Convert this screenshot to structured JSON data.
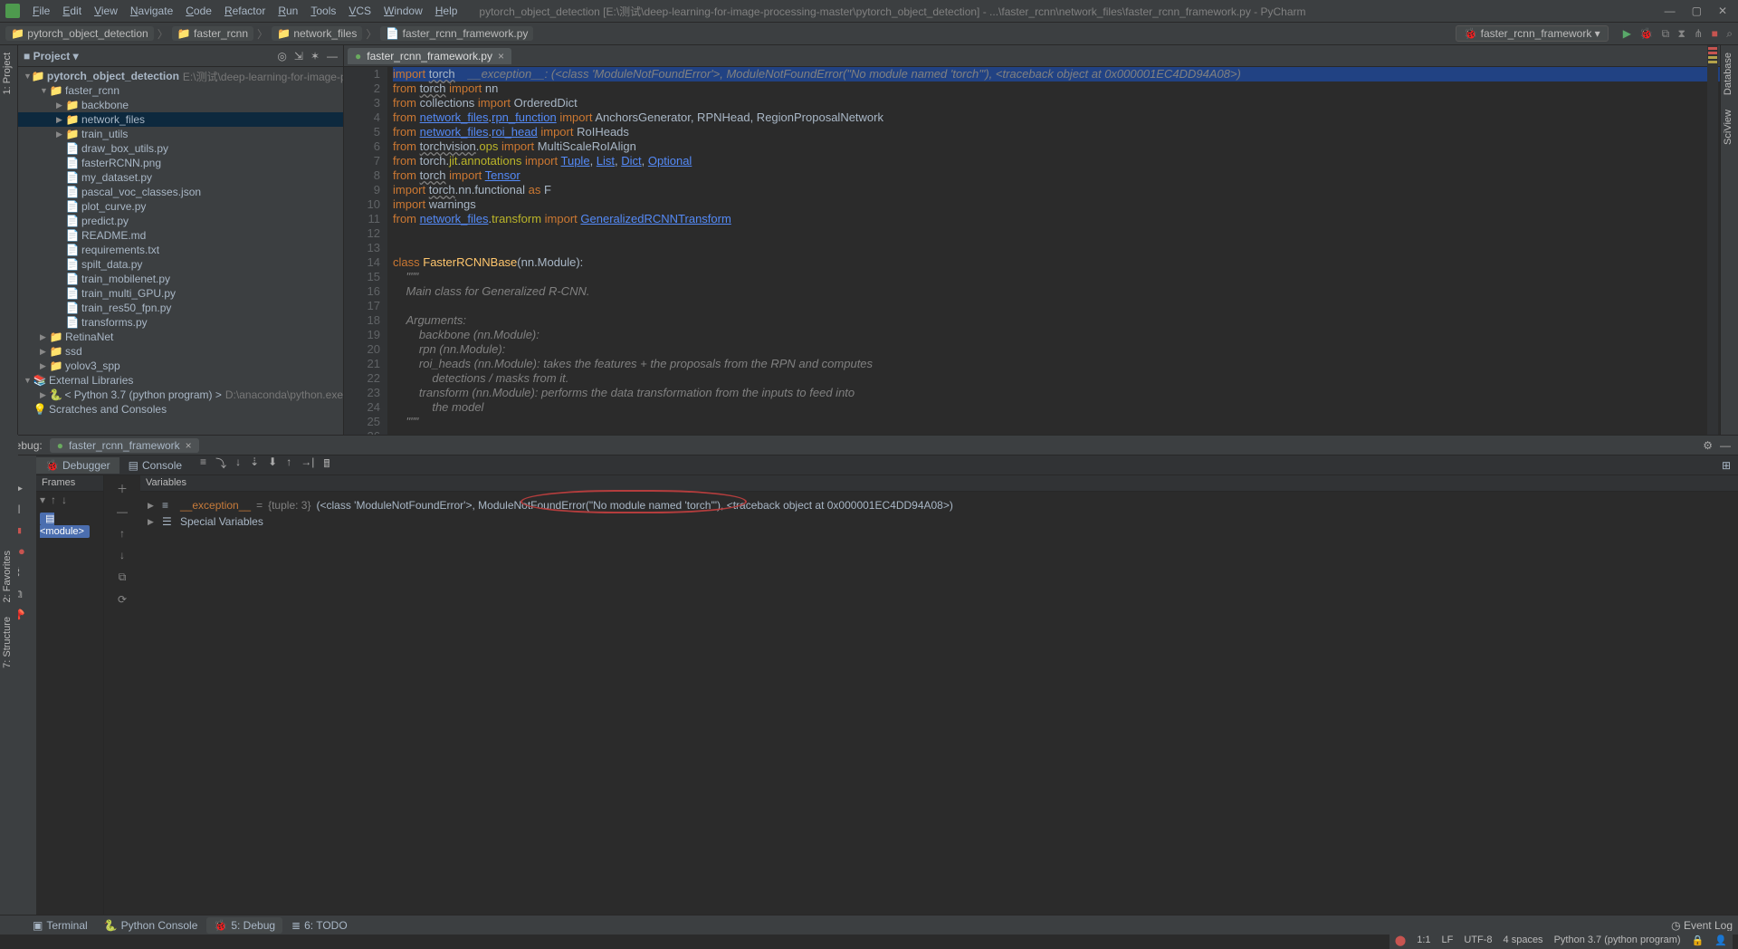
{
  "title": "pytorch_object_detection [E:\\测试\\deep-learning-for-image-processing-master\\pytorch_object_detection] - ...\\faster_rcnn\\network_files\\faster_rcnn_framework.py - PyCharm",
  "menu": [
    "File",
    "Edit",
    "View",
    "Navigate",
    "Code",
    "Refactor",
    "Run",
    "Tools",
    "VCS",
    "Window",
    "Help"
  ],
  "breadcrumb": [
    "pytorch_object_detection",
    "faster_rcnn",
    "network_files",
    "faster_rcnn_framework.py"
  ],
  "run_config": "faster_rcnn_framework",
  "project_pane": {
    "title": "Project"
  },
  "tree": [
    {
      "d": 0,
      "arrow": "▼",
      "ic": "📁",
      "lbl": "pytorch_object_detection",
      "hint": "E:\\测试\\deep-learning-for-image-processing-m",
      "bold": true
    },
    {
      "d": 1,
      "arrow": "▼",
      "ic": "📁",
      "lbl": "faster_rcnn"
    },
    {
      "d": 2,
      "arrow": "▶",
      "ic": "📁",
      "lbl": "backbone"
    },
    {
      "d": 2,
      "arrow": "▶",
      "ic": "📁",
      "lbl": "network_files",
      "selected": true
    },
    {
      "d": 2,
      "arrow": "▶",
      "ic": "📁",
      "lbl": "train_utils"
    },
    {
      "d": 2,
      "arrow": "",
      "ic": "📄",
      "lbl": "draw_box_utils.py"
    },
    {
      "d": 2,
      "arrow": "",
      "ic": "📄",
      "lbl": "fasterRCNN.png"
    },
    {
      "d": 2,
      "arrow": "",
      "ic": "📄",
      "lbl": "my_dataset.py"
    },
    {
      "d": 2,
      "arrow": "",
      "ic": "📄",
      "lbl": "pascal_voc_classes.json"
    },
    {
      "d": 2,
      "arrow": "",
      "ic": "📄",
      "lbl": "plot_curve.py"
    },
    {
      "d": 2,
      "arrow": "",
      "ic": "📄",
      "lbl": "predict.py"
    },
    {
      "d": 2,
      "arrow": "",
      "ic": "📄",
      "lbl": "README.md"
    },
    {
      "d": 2,
      "arrow": "",
      "ic": "📄",
      "lbl": "requirements.txt"
    },
    {
      "d": 2,
      "arrow": "",
      "ic": "📄",
      "lbl": "spilt_data.py"
    },
    {
      "d": 2,
      "arrow": "",
      "ic": "📄",
      "lbl": "train_mobilenet.py"
    },
    {
      "d": 2,
      "arrow": "",
      "ic": "📄",
      "lbl": "train_multi_GPU.py"
    },
    {
      "d": 2,
      "arrow": "",
      "ic": "📄",
      "lbl": "train_res50_fpn.py"
    },
    {
      "d": 2,
      "arrow": "",
      "ic": "📄",
      "lbl": "transforms.py"
    },
    {
      "d": 1,
      "arrow": "▶",
      "ic": "📁",
      "lbl": "RetinaNet"
    },
    {
      "d": 1,
      "arrow": "▶",
      "ic": "📁",
      "lbl": "ssd"
    },
    {
      "d": 1,
      "arrow": "▶",
      "ic": "📁",
      "lbl": "yolov3_spp"
    },
    {
      "d": 0,
      "arrow": "▼",
      "ic": "📚",
      "lbl": "External Libraries"
    },
    {
      "d": 1,
      "arrow": "▶",
      "ic": "🐍",
      "lbl": "< Python 3.7 (python program) >",
      "hint": "D:\\anaconda\\python.exe"
    },
    {
      "d": 0,
      "arrow": "",
      "ic": "💡",
      "lbl": "Scratches and Consoles"
    }
  ],
  "editor_tab": "faster_rcnn_framework.py",
  "code_lines": [
    {
      "n": 1,
      "html": "<span class='kw'>import</span> <span class='wave'>torch</span>    <span class='err'>__exception__: (&lt;class 'ModuleNotFoundError'&gt;, ModuleNotFoundError(\"No module named 'torch'\"), &lt;traceback object at 0x000001EC4DD94A08&gt;)</span>",
      "hl": true,
      "bolt": true
    },
    {
      "n": 2,
      "html": "<span class='kw'>from</span> <span class='wave'>torch</span> <span class='kw'>import</span> nn"
    },
    {
      "n": 3,
      "html": "<span class='kw'>from</span> collections <span class='kw'>import</span> OrderedDict"
    },
    {
      "n": 4,
      "html": "<span class='kw'>from</span> <span class='link'>network_files</span>.<span class='link'>rpn_function</span> <span class='kw'>import</span> AnchorsGenerator, RPNHead, RegionProposalNetwork"
    },
    {
      "n": 5,
      "html": "<span class='kw'>from</span> <span class='link'>network_files</span>.<span class='link'>roi_head</span> <span class='kw'>import</span> RoIHeads"
    },
    {
      "n": 6,
      "html": "<span class='kw'>from</span> <span class='wave'>torchvision</span>.<span class='dec'>ops</span> <span class='kw'>import</span> MultiScaleRoIAlign"
    },
    {
      "n": 7,
      "html": "<span class='kw'>from</span> torch.<span class='dec'>jit</span>.<span class='dec'>annotations</span> <span class='kw'>import</span> <span class='link'>Tuple</span>, <span class='link'>List</span>, <span class='link'>Dict</span>, <span class='link'>Optional</span>"
    },
    {
      "n": 8,
      "html": "<span class='kw'>from</span> <span class='wave'>torch</span> <span class='kw'>import</span> <span class='link'>Tensor</span>"
    },
    {
      "n": 9,
      "html": "<span class='kw'>import</span> <span class='wave'>torch</span>.nn.functional <span class='kw'>as</span> F"
    },
    {
      "n": 10,
      "html": "<span class='kw'>import</span> warnings"
    },
    {
      "n": 11,
      "html": "<span class='kw'>from</span> <span class='link'>network_files</span>.<span class='dec'>transform</span> <span class='kw'>import</span> <span class='link'>GeneralizedRCNNTransform</span>"
    },
    {
      "n": 12,
      "html": ""
    },
    {
      "n": 13,
      "html": ""
    },
    {
      "n": 14,
      "html": "<span class='kw'>class</span> <span class='func'>FasterRCNNBase</span>(nn.Module):"
    },
    {
      "n": 15,
      "html": "    <span class='com'>\"\"\"</span>"
    },
    {
      "n": 16,
      "html": "    <span class='com'>Main class for Generalized R-CNN.</span>"
    },
    {
      "n": 17,
      "html": ""
    },
    {
      "n": 18,
      "html": "    <span class='com'>Arguments:</span>"
    },
    {
      "n": 19,
      "html": "        <span class='com'>backbone (nn.Module):</span>"
    },
    {
      "n": 20,
      "html": "        <span class='com'>rpn (nn.Module):</span>"
    },
    {
      "n": 21,
      "html": "        <span class='com'>roi_heads (nn.Module): takes the features + the proposals from the RPN and computes</span>"
    },
    {
      "n": 22,
      "html": "            <span class='com'>detections / masks from it.</span>"
    },
    {
      "n": 23,
      "html": "        <span class='com'>transform (nn.Module): performs the data transformation from the inputs to feed into</span>"
    },
    {
      "n": 24,
      "html": "            <span class='com'>the model</span>"
    },
    {
      "n": 25,
      "html": "    <span class='com'>\"\"\"</span>"
    },
    {
      "n": 26,
      "html": ""
    }
  ],
  "debug": {
    "title": "Debug:",
    "tab": "faster_rcnn_framework",
    "subtabs": [
      "Debugger",
      "Console"
    ],
    "frames_title": "Frames",
    "vars_title": "Variables",
    "frame": "<module>",
    "var_exception": {
      "name": "__exception__",
      "type": "{tuple: 3}",
      "value": "(<class 'ModuleNotFoundError'>, ModuleNotFoundError(\"No module named 'torch'\"), <traceback object at 0x000001EC4DD94A08>)"
    },
    "special": "Special Variables"
  },
  "bottom_tabs": [
    "Terminal",
    "Python Console",
    "5: Debug",
    "6: TODO"
  ],
  "event_log": "Event Log",
  "status": {
    "pos": "1:1",
    "le": "LF",
    "enc": "UTF-8",
    "indent": "4 spaces",
    "interp": "Python 3.7 (python program)"
  },
  "side_r": [
    "Database",
    "SciView"
  ],
  "side_l_top": "1: Project",
  "side_l_bottom": [
    "2: Favorites",
    "7: Structure"
  ]
}
